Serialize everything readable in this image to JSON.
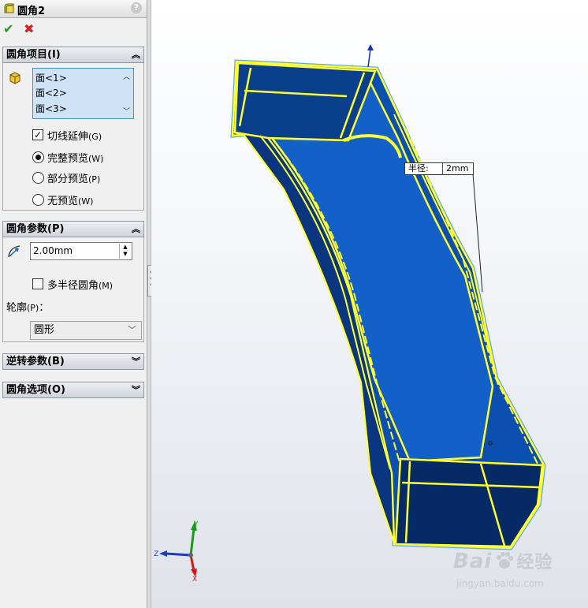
{
  "panel": {
    "title": "圆角2",
    "help": "?",
    "ok": "✔",
    "cancel": "✖"
  },
  "sections": {
    "items": {
      "title": "圆角项目(I)",
      "faces": [
        "面<1>",
        "面<2>",
        "面<3>"
      ],
      "tangent_label": "切线延伸",
      "tangent_key": "(G)",
      "tangent_checked": true,
      "previews": [
        {
          "label": "完整预览",
          "key": "(W)",
          "selected": true
        },
        {
          "label": "部分预览",
          "key": "(P)",
          "selected": false
        },
        {
          "label": "无预览",
          "key": "(W)",
          "selected": false
        }
      ]
    },
    "params": {
      "title": "圆角参数(P)",
      "radius_value": "2.00mm",
      "multi_radius_label": "多半径圆角",
      "multi_radius_key": "(M)",
      "multi_radius_checked": false,
      "profile_label": "轮廓",
      "profile_key": "(P)",
      "profile_colon": "：",
      "profile_value": "圆形"
    },
    "reverse": {
      "title": "逆转参数(B)"
    },
    "options": {
      "title": "圆角选项(O)"
    }
  },
  "viewport": {
    "callout_key": "半径:",
    "callout_value": "2mm",
    "triad": {
      "y": "Y",
      "z": "Z",
      "x": "X"
    },
    "model_fill": "#0b4fb0",
    "edge_highlight": "#ffff33"
  },
  "watermark": {
    "brand": "Bai",
    "brand_cn": "经验",
    "url": "jingyan.baidu.com"
  }
}
